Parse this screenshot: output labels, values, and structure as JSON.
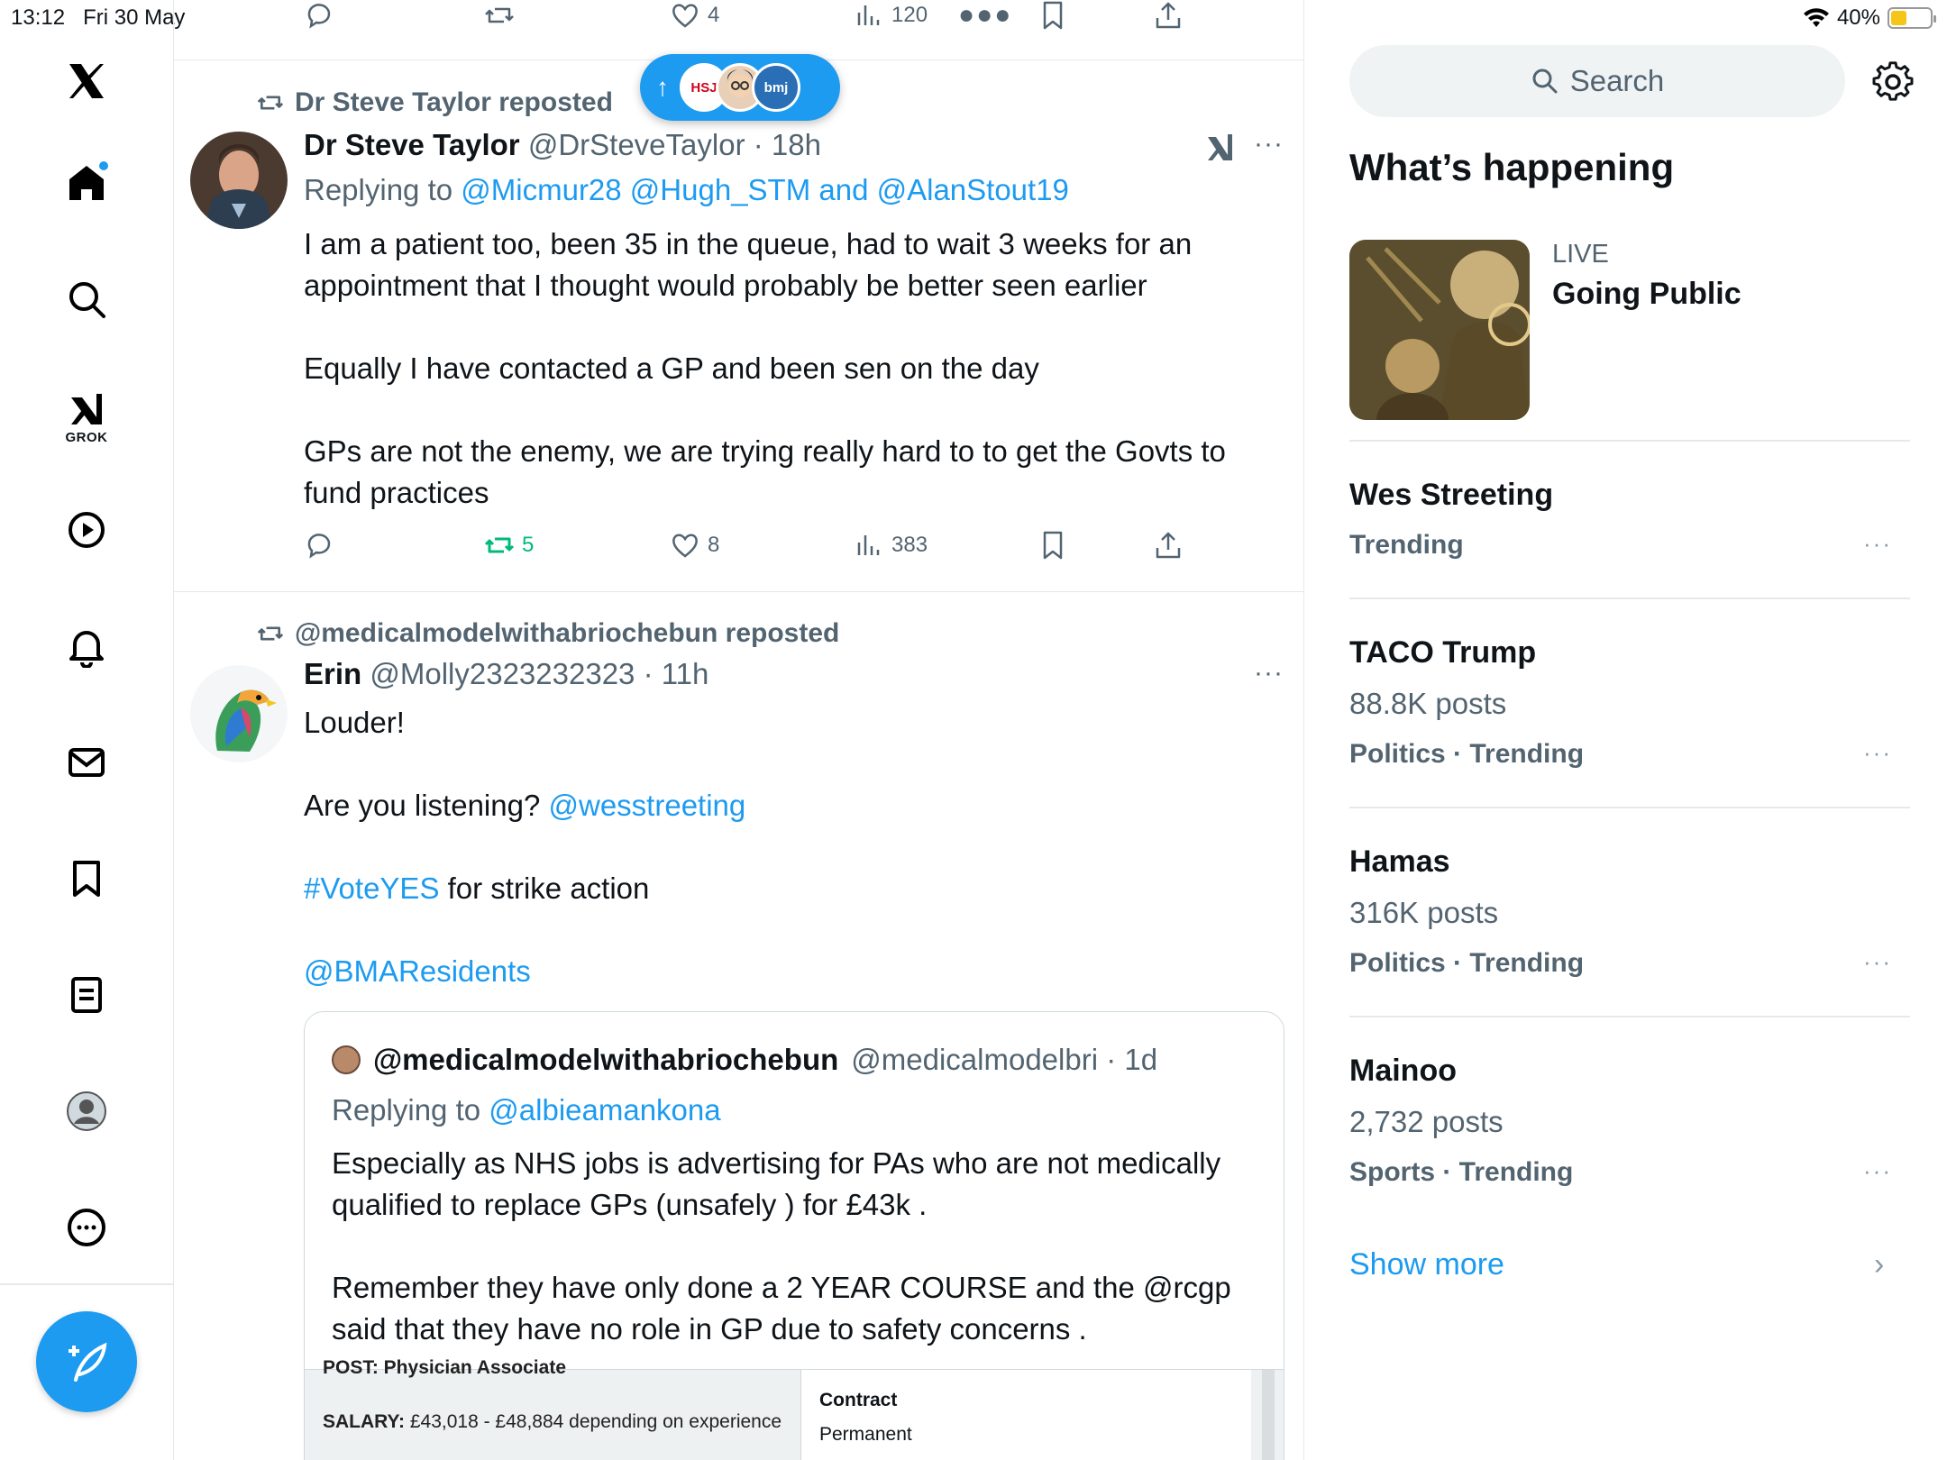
{
  "status_bar": {
    "time": "13:12",
    "date": "Fri 30 May",
    "battery": "40%",
    "battery_level": 0.4
  },
  "nav": {
    "items": [
      {
        "name": "x-logo"
      },
      {
        "name": "home"
      },
      {
        "name": "explore"
      },
      {
        "name": "grok",
        "label": "GROK"
      },
      {
        "name": "video"
      },
      {
        "name": "notifications"
      },
      {
        "name": "messages"
      },
      {
        "name": "bookmarks"
      },
      {
        "name": "lists"
      },
      {
        "name": "profile"
      },
      {
        "name": "more"
      }
    ]
  },
  "top_actions": {
    "likes": "4",
    "views": "120"
  },
  "new_posts_pill": {
    "avatar_1": "HSJ",
    "avatar_3": "bmj"
  },
  "tweet1": {
    "repost_label": "Dr Steve Taylor reposted",
    "name": "Dr Steve Taylor",
    "handle": "@DrSteveTaylor",
    "time": "18h",
    "reply_prefix": "Replying to",
    "reply_targets": "@Micmur28 @Hugh_STM and @AlanStout19",
    "paragraphs": [
      "I am a patient too, been 35 in the queue, had to wait 3 weeks for an appointment that I thought would probably be better seen earlier",
      "Equally I have contacted a GP and been sen on the day",
      "GPs are not the enemy, we are trying really hard to to get the Govts to fund practices"
    ],
    "reposts": "5",
    "likes": "8",
    "views": "383"
  },
  "tweet2": {
    "repost_label": "@medicalmodelwithabriochebun reposted",
    "name": "Erin",
    "handle": "@Molly2323232323",
    "time": "11h",
    "line1": "Louder!",
    "line2_text": "Are you listening?",
    "line2_link": "@wesstreeting",
    "line3_tag": "#VoteYES",
    "line3_text": "for strike action",
    "line4_link": "@BMAResidents",
    "quote": {
      "name": "@medicalmodelwithabriochebun",
      "handle": "@medicalmodelbri",
      "time": "1d",
      "reply_prefix": "Replying to",
      "reply_target": "@albieamankona",
      "paragraph1": "Especially as NHS jobs is advertising for PAs who are not medically qualified to replace GPs (unsafely ) for £43k .",
      "paragraph2": "Remember they have only done a 2 YEAR COURSE and the @rcgp said that they have no role in GP due to safety concerns .",
      "image": {
        "post_cut": "POST: Physician Associate",
        "salary_label": "SALARY:",
        "salary_value": "£43,018 - £48,884 depending on experience",
        "contract_heading": "Contract",
        "contract_value": "Permanent"
      }
    }
  },
  "sidebar": {
    "search_placeholder": "Search",
    "section_title": "What’s happening",
    "live_label": "LIVE",
    "live_title": "Going Public",
    "trends": [
      {
        "name": "Wes Streeting",
        "posts": "",
        "category": "Trending"
      },
      {
        "name": "TACO Trump",
        "posts": "88.8K posts",
        "category": "Politics · Trending"
      },
      {
        "name": "Hamas",
        "posts": "316K posts",
        "category": "Politics · Trending"
      },
      {
        "name": "Mainoo",
        "posts": "2,732 posts",
        "category": "Sports · Trending"
      }
    ],
    "show_more": "Show more"
  }
}
